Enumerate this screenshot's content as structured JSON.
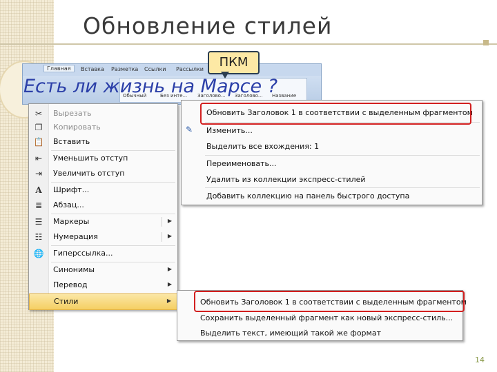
{
  "slide": {
    "title": "Обновление стилей",
    "overlay_text": "Есть ли жизнь на Марсе ?",
    "callout": "ПКМ",
    "page_number": "14"
  },
  "ribbon": {
    "tabs": [
      "Главная",
      "Вставка",
      "Разметка",
      "Ссылки",
      "Рассылки"
    ],
    "styles": [
      "Обычный",
      "Без инте...",
      "Заголово...",
      "Заголово...",
      "Название"
    ]
  },
  "context_menu": {
    "items": [
      {
        "label": "Вырезать",
        "icon": "scissors-icon",
        "disabled": true
      },
      {
        "label": "Копировать",
        "icon": "copy-icon",
        "disabled": true
      },
      {
        "label": "Вставить",
        "icon": "paste-icon",
        "disabled": false
      },
      {
        "label": "Уменьшить отступ",
        "icon": "decrease-indent-icon",
        "disabled": false
      },
      {
        "label": "Увеличить отступ",
        "icon": "increase-indent-icon",
        "disabled": false
      },
      {
        "label": "Шрифт...",
        "icon": "font-icon",
        "disabled": false
      },
      {
        "label": "Абзац...",
        "icon": "paragraph-icon",
        "disabled": false
      },
      {
        "label": "Маркеры",
        "icon": "bullets-icon",
        "disabled": false,
        "submenu": true
      },
      {
        "label": "Нумерация",
        "icon": "numbering-icon",
        "disabled": false,
        "submenu": true
      },
      {
        "label": "Гиперссылка...",
        "icon": "hyperlink-icon",
        "disabled": false
      },
      {
        "label": "Синонимы",
        "icon": "",
        "disabled": false,
        "submenu": true
      },
      {
        "label": "Перевод",
        "icon": "",
        "disabled": false,
        "submenu": true
      },
      {
        "label": "Стили",
        "icon": "",
        "disabled": false,
        "submenu": true,
        "highlighted": true
      }
    ]
  },
  "styles_submenu_top": {
    "items": [
      {
        "label": "Обновить Заголовок 1 в соответствии с выделенным фрагментом",
        "highlighted": true
      },
      {
        "label": "Изменить...",
        "icon": "modify-style-icon"
      },
      {
        "label": "Выделить все вхождения: 1"
      },
      {
        "label": "Переименовать..."
      },
      {
        "label": "Удалить из коллекции экспресс-стилей"
      },
      {
        "label": "Добавить коллекцию на панель быстрого доступа"
      }
    ]
  },
  "styles_submenu_bottom": {
    "items": [
      {
        "label": "Обновить Заголовок 1 в соответствии с выделенным фрагментом",
        "highlighted": true
      },
      {
        "label": "Сохранить выделенный фрагмент как новый экспресс-стиль..."
      },
      {
        "label": "Выделить текст, имеющий такой же формат"
      }
    ]
  },
  "colors": {
    "highlight_border": "#d21f1f",
    "menu_highlight": "#f5cf63",
    "overlay_text": "#2b3fa8"
  }
}
